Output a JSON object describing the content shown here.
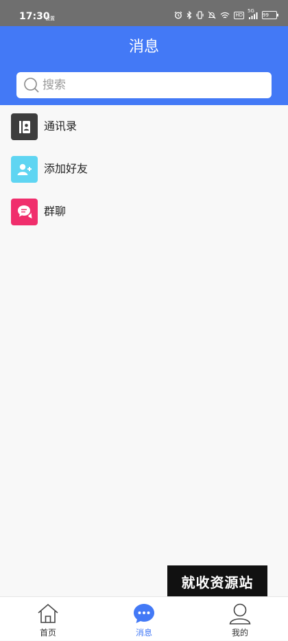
{
  "status_bar": {
    "time": "17:30",
    "carrier_note": "设置",
    "hd": "HD",
    "network": "5G",
    "battery": "99",
    "icons": [
      "alarm-icon",
      "bluetooth-icon",
      "vibrate-icon",
      "mute-icon",
      "wifi-icon",
      "hd-icon",
      "signal-icon",
      "battery-icon"
    ]
  },
  "header": {
    "title": "消息",
    "background_color": "#4379f6"
  },
  "search": {
    "placeholder": "搜索",
    "value": ""
  },
  "menu": {
    "items": [
      {
        "label": "通讯录",
        "icon": "contacts-icon",
        "color": "#3d3d3d"
      },
      {
        "label": "添加好友",
        "icon": "add-friend-icon",
        "color": "#5fd5f2"
      },
      {
        "label": "群聊",
        "icon": "group-chat-icon",
        "color": "#f02e6c"
      }
    ]
  },
  "watermark": {
    "text": "就收资源站"
  },
  "bottom_nav": {
    "tabs": [
      {
        "label": "首页",
        "icon": "home-icon",
        "active": false
      },
      {
        "label": "消息",
        "icon": "message-icon",
        "active": true
      },
      {
        "label": "我的",
        "icon": "profile-icon",
        "active": false
      }
    ],
    "active_color": "#4379f6"
  }
}
